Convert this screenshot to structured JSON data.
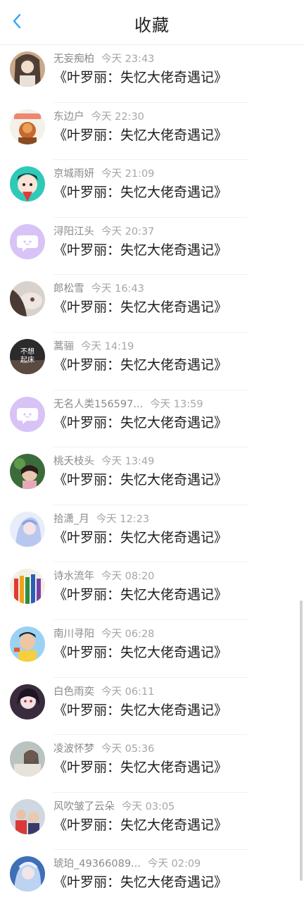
{
  "header": {
    "title": "收藏",
    "back_icon": "chevron-left-icon"
  },
  "colors": {
    "accent": "#2aa6f0",
    "placeholder_avatar": "#d8c3f7"
  },
  "items": [
    {
      "name": "无妄痴柏",
      "time": "今天 23:43",
      "book": "《叶罗丽：失忆大佬奇遇记》"
    },
    {
      "name": "东边户",
      "time": "今天 22:30",
      "book": "《叶罗丽：失忆大佬奇遇记》"
    },
    {
      "name": "京城雨妍",
      "time": "今天 21:09",
      "book": "《叶罗丽：失忆大佬奇遇记》"
    },
    {
      "name": "浔阳江头",
      "time": "今天 20:37",
      "book": "《叶罗丽：失忆大佬奇遇记》"
    },
    {
      "name": "郎松雪",
      "time": "今天 16:43",
      "book": "《叶罗丽：失忆大佬奇遇记》"
    },
    {
      "name": "蒿骊",
      "time": "今天 14:19",
      "book": "《叶罗丽：失忆大佬奇遇记》",
      "avatar_text": "不想起床"
    },
    {
      "name": "无名人类156597...",
      "time": "今天 13:59",
      "book": "《叶罗丽：失忆大佬奇遇记》"
    },
    {
      "name": "桃夭枝头",
      "time": "今天 13:49",
      "book": "《叶罗丽：失忆大佬奇遇记》"
    },
    {
      "name": "拾潇_月",
      "time": "今天 12:23",
      "book": "《叶罗丽：失忆大佬奇遇记》"
    },
    {
      "name": "诗水流年",
      "time": "今天 08:20",
      "book": "《叶罗丽：失忆大佬奇遇记》"
    },
    {
      "name": "南川寻阳",
      "time": "今天 06:28",
      "book": "《叶罗丽：失忆大佬奇遇记》"
    },
    {
      "name": "白色雨奕",
      "time": "今天 06:11",
      "book": "《叶罗丽：失忆大佬奇遇记》"
    },
    {
      "name": "凌波怀梦",
      "time": "今天 05:36",
      "book": "《叶罗丽：失忆大佬奇遇记》"
    },
    {
      "name": "风吹皱了云朵",
      "time": "今天 03:05",
      "book": "《叶罗丽：失忆大佬奇遇记》"
    },
    {
      "name": "琥珀_49366089...",
      "time": "今天 02:09",
      "book": "《叶罗丽：失忆大佬奇遇记》"
    }
  ]
}
